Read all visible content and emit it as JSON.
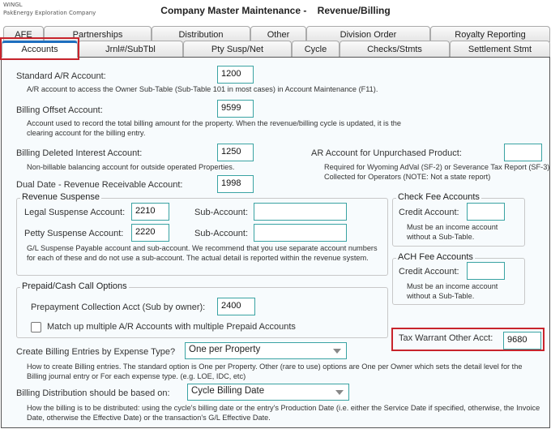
{
  "app": {
    "line1": "WINGL",
    "line2": "PakEnergy Exploration Company",
    "title": "Company Master Maintenance -    Revenue/Billing"
  },
  "tabs_back": [
    "AFE",
    "Partnerships",
    "Distribution",
    "Other",
    "Division Order",
    "Royalty Reporting"
  ],
  "tabs_front": [
    "Accounts",
    "Jrnl#/SubTbl",
    "Pty Susp/Net",
    "Cycle",
    "Checks/Stmts",
    "Settlement Stmt"
  ],
  "fields": {
    "std_ar": {
      "label": "Standard A/R Account:",
      "value": "1200",
      "desc": "A/R account to access the Owner Sub-Table (Sub-Table 101 in most cases) in Account Maintenance (F11)."
    },
    "offset": {
      "label": "Billing Offset Account:",
      "value": "9599",
      "desc": "Account used to record the total billing amount for the property.  When the revenue/billing cycle is updated, it is the clearing account for the billing entry."
    },
    "deleted": {
      "label": "Billing Deleted Interest Account:",
      "value": "1250",
      "desc": "Non-billable balancing account for outside operated Properties."
    },
    "unpurch": {
      "label": "AR Account for Unpurchased Product:",
      "value": "",
      "desc": "Required for Wyoming AdVal (SF-2) or Severance Tax Report (SF-3) Collected for Operators (NOTE: Not a state report)"
    },
    "dual": {
      "label": "Dual Date - Revenue Receivable Account:",
      "value": "1998"
    }
  },
  "revenue_suspense": {
    "title": "Revenue Suspense",
    "legal_label": "Legal Suspense Account:",
    "legal_value": "2210",
    "petty_label": "Petty Suspense Account:",
    "petty_value": "2220",
    "sub_label": "Sub-Account:",
    "sub1": "",
    "sub2": "",
    "desc": "G/L Suspense Payable account and sub-account.  We recommend that you use separate account numbers for each of these and do not use a sub-account.  The actual detail is reported within the revenue system."
  },
  "check_fee": {
    "title": "Check Fee Accounts",
    "label": "Credit Account:",
    "value": "",
    "desc": "Must be an income account without a Sub-Table."
  },
  "ach_fee": {
    "title": "ACH Fee Accounts",
    "label": "Credit Account:",
    "value": "",
    "desc": "Must be an income account without a Sub-Table."
  },
  "prepaid": {
    "title": "Prepaid/Cash Call Options",
    "label": "Prepayment Collection Acct (Sub by owner):",
    "value": "2400",
    "checkbox_label": "Match up multiple A/R Accounts with multiple Prepaid Accounts",
    "checked": false
  },
  "tax_warrant": {
    "label": "Tax Warrant Other Acct:",
    "value": "9680"
  },
  "billing_entries": {
    "label": "Create Billing Entries by Expense Type?",
    "value": "One per Property",
    "desc": "How to create Billing entries.  The standard option is One per Property.  Other (rare to use) options are One per Owner which sets the detail level for the Billing journal entry or For each expense type. (e.g. LOE, IDC, etc)"
  },
  "billing_dist": {
    "label": "Billing Distribution should be based on:",
    "value": "Cycle Billing Date",
    "desc": "How the billing is to be distributed: using the cycle's billing date or the entry's Production Date (i.e. either the Service Date if specified, otherwise, the Invoice Date, otherwise the Effective Date) or the transaction's G/L Effective Date."
  },
  "colors": {
    "accent": "#1e6fbf",
    "input_border": "#3aa3a3",
    "highlight": "#c8242c"
  }
}
